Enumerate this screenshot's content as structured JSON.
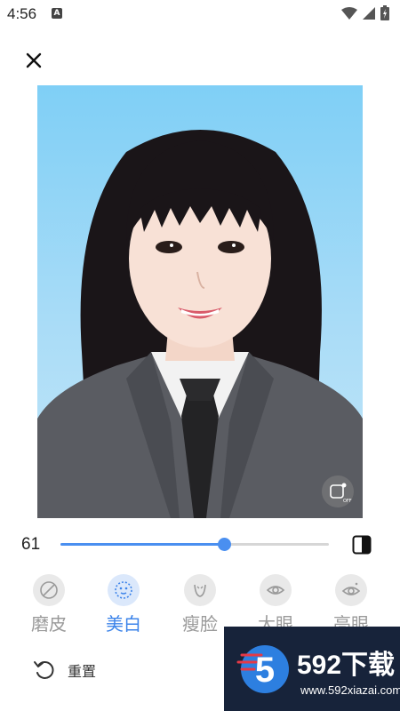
{
  "status_bar": {
    "time": "4:56",
    "notification_icon": "a-icon",
    "icons": [
      "wifi-icon",
      "cell-signal-icon",
      "battery-charging-icon"
    ]
  },
  "header": {
    "close_icon": "close-icon"
  },
  "photo": {
    "compare_icon": "compare-toggle-icon",
    "compare_label": "OFF"
  },
  "slider": {
    "value": "61",
    "fraction": 0.61,
    "accent": "#4a8ff0",
    "split_icon": "split-view-icon"
  },
  "tools": [
    {
      "label": "磨皮",
      "icon": "smooth-skin-icon",
      "active": false
    },
    {
      "label": "美白",
      "icon": "whiten-icon",
      "active": true
    },
    {
      "label": "瘦脸",
      "icon": "slim-face-icon",
      "active": false
    },
    {
      "label": "大眼",
      "icon": "big-eye-icon",
      "active": false
    },
    {
      "label": "亮眼",
      "icon": "bright-eye-icon",
      "active": false
    }
  ],
  "reset": {
    "label": "重置",
    "icon": "undo-icon"
  },
  "watermark": {
    "brand": "592下载",
    "url": "www.592xiazai.com",
    "logo_glyph": "5"
  },
  "colors": {
    "active": "#3d84ea",
    "inactive": "#9a9a9a"
  }
}
